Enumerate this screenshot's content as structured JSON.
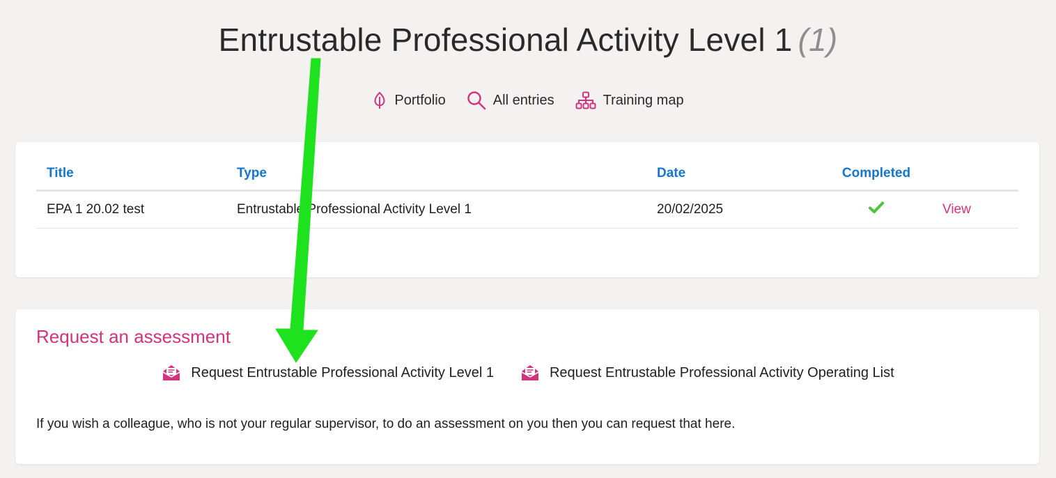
{
  "header": {
    "title": "Entrustable Professional Activity Level 1",
    "count": "(1)"
  },
  "nav": {
    "portfolio": "Portfolio",
    "all_entries": "All entries",
    "training_map": "Training map"
  },
  "table": {
    "columns": [
      "Title",
      "Type",
      "Date",
      "Completed"
    ],
    "rows": [
      {
        "title": "EPA 1 20.02 test",
        "type": "Entrustable Professional Activity Level 1",
        "date": "20/02/2025",
        "completed": true,
        "action": "View"
      }
    ]
  },
  "request": {
    "heading": "Request an assessment",
    "link_1": "Request Entrustable Professional Activity Level 1",
    "link_2": "Request Entrustable Professional Activity Operating List",
    "note": "If you wish a colleague, who is not your regular supervisor, to do an assessment on you then you can request that here."
  },
  "colors": {
    "accent_pink": "#d1337f",
    "header_blue": "#1476cc",
    "check_green": "#4cc43c",
    "annotation_arrow": "#1fe21f"
  },
  "icons": {
    "portfolio": "leaf-icon",
    "all_entries": "search-icon",
    "training_map": "sitemap-icon",
    "completed": "checkmark-icon",
    "request": "envelope-open-icon"
  }
}
